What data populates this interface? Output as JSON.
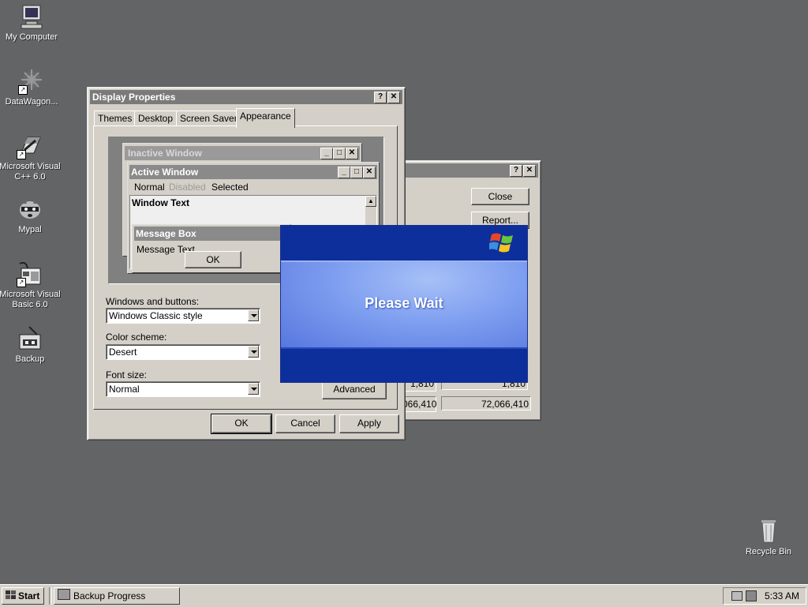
{
  "desktop": {
    "icons": [
      {
        "label": "My Computer"
      },
      {
        "label": "DataWagon..."
      },
      {
        "label": "Microsoft Visual C++ 6.0"
      },
      {
        "label": "Mypal"
      },
      {
        "label": "Microsoft Visual Basic 6.0"
      },
      {
        "label": "Backup"
      },
      {
        "label": "Recycle Bin"
      }
    ]
  },
  "back_window": {
    "buttons": {
      "close": "Close",
      "report": "Report..."
    },
    "fields": {
      "f1": "1,810",
      "f2": "1,810",
      "f3": "066,410",
      "f4": "72,066,410"
    }
  },
  "display_properties": {
    "title": "Display Properties",
    "help_btn": "?",
    "close_btn": "✕",
    "tabs": [
      "Themes",
      "Desktop",
      "Screen Saver",
      "Appearance"
    ],
    "selected_tab": "Appearance",
    "preview": {
      "inactive_title": "Inactive Window",
      "active_title": "Active Window",
      "menu": [
        "Normal",
        "Disabled",
        "Selected"
      ],
      "window_text": "Window Text",
      "message_box_title": "Message Box",
      "message_text": "Message Text",
      "ok": "OK"
    },
    "windows_and_buttons_label": "Windows and buttons:",
    "windows_and_buttons_value": "Windows Classic style",
    "color_scheme_label": "Color scheme:",
    "color_scheme_value": "Desert",
    "font_size_label": "Font size:",
    "font_size_value": "Normal",
    "advanced": "Advanced",
    "ok": "OK",
    "cancel": "Cancel",
    "apply": "Apply"
  },
  "please_wait": {
    "message": "Please Wait"
  },
  "taskbar": {
    "start": "Start",
    "task": "Backup Progress",
    "clock": "5:33 AM"
  }
}
